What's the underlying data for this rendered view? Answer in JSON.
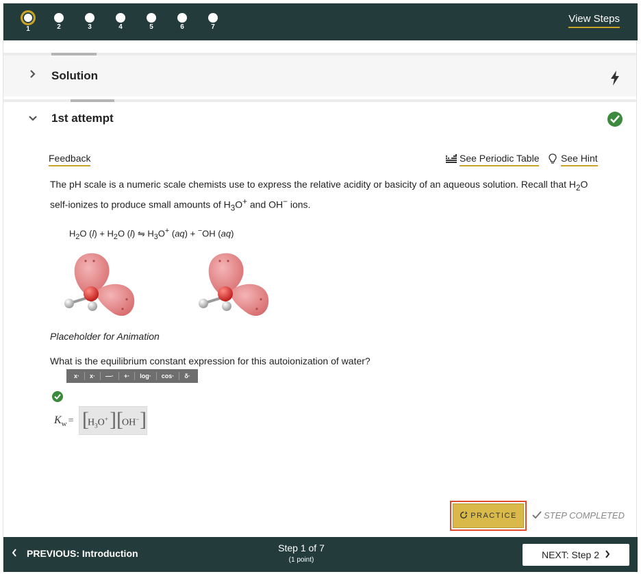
{
  "steps": {
    "items": [
      "1",
      "2",
      "3",
      "4",
      "5",
      "6",
      "7"
    ],
    "active_index": 0,
    "view_label": "View Steps"
  },
  "solution": {
    "label": "Solution"
  },
  "attempt": {
    "label": "1st attempt",
    "feedback_label": "Feedback",
    "periodic_label": "See Periodic Table",
    "hint_label": "See Hint",
    "para_1a": "The pH scale is a numeric scale chemists use to express the relative acidity or basicity of an aqueous solution.  Recall that H",
    "para_sub_2": "2",
    "para_1b": "O",
    "para_2a": "self-ionizes to produce small amounts of H",
    "para_sub_3": "3",
    "para_sup_plus": "+",
    "para_2b": "O",
    "para_2c": " and OH",
    "para_sup_minus": "−",
    "para_2d": " ions.",
    "equation": {
      "h2o_a": "H",
      "sub2": "2",
      "o_a": "O (",
      "l": "l",
      "close_plus": ") + H",
      "o_b": "O (",
      "arrow": ") ⇋ H",
      "sub3": "3",
      "o_c": "O",
      "plus": "+",
      "aq_open": " (",
      "aq": "aq",
      "mid": ") + ",
      "minus": "−",
      "oh": "OH (",
      "end": ")"
    },
    "caption": "Placeholder for Animation",
    "question": "What is the equilibrium constant expression for this autoionization of water?",
    "toolbar": [
      "x·",
      "x·",
      "—·",
      "+·",
      "log·",
      "cos·",
      "δ·"
    ],
    "kw_label": "K",
    "kw_sub": "w",
    "kw_eq": "=",
    "answer": {
      "h": "H",
      "sub3": "3",
      "o": "O",
      "plus": "+",
      "oh": "OH",
      "minus": "−"
    },
    "practice_label": "PRACTICE",
    "step_completed": "STEP COMPLETED"
  },
  "bottom": {
    "prev_label": "PREVIOUS: Introduction",
    "step_label": "Step 1 of 7",
    "points_label": "(1 point)",
    "next_label": "NEXT: Step 2"
  },
  "colors": {
    "bar": "#233b3b",
    "accent": "#c9a227",
    "success": "#3b8a3e",
    "practice": "#d9b94a",
    "highlight": "#e04a2f",
    "oxygen": "#d8413e",
    "lobe": "#e8888a"
  }
}
